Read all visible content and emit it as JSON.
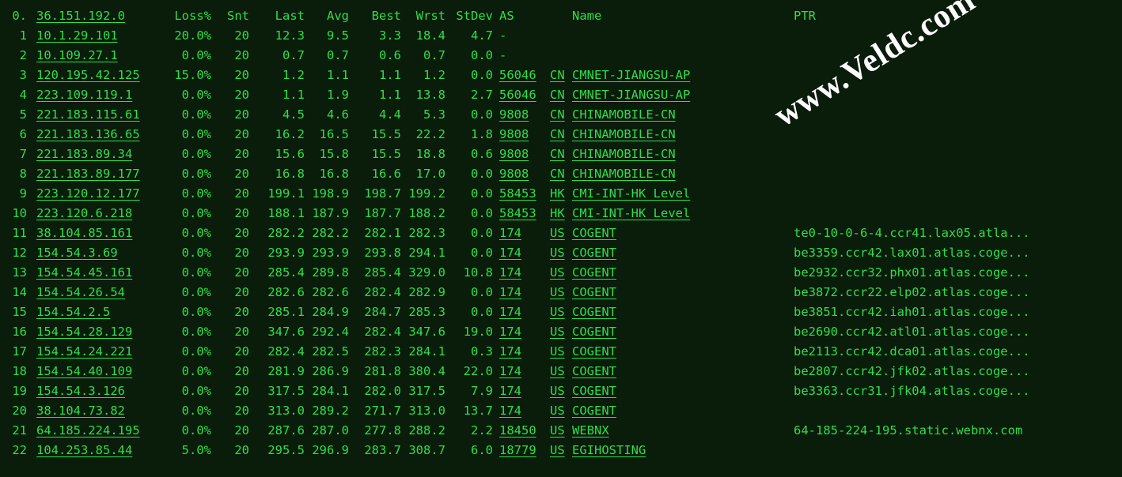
{
  "watermark": "www.Veldc.com",
  "header": {
    "hop": "0.",
    "ip": "36.151.192.0",
    "loss": "Loss%",
    "snt": "Snt",
    "last": "Last",
    "avg": "Avg",
    "best": "Best",
    "wrst": "Wrst",
    "stdev": "StDev",
    "as": "AS",
    "name": "Name",
    "ptr": "PTR"
  },
  "rows": [
    {
      "hop": "1",
      "ip": "10.1.29.101",
      "loss": "20.0%",
      "snt": "20",
      "last": "12.3",
      "avg": "9.5",
      "best": "3.3",
      "wrst": "18.4",
      "stdev": "4.7",
      "as": "-",
      "cc": "",
      "name": "",
      "ptr": ""
    },
    {
      "hop": "2",
      "ip": "10.109.27.1",
      "loss": "0.0%",
      "snt": "20",
      "last": "0.7",
      "avg": "0.7",
      "best": "0.6",
      "wrst": "0.7",
      "stdev": "0.0",
      "as": "-",
      "cc": "",
      "name": "",
      "ptr": ""
    },
    {
      "hop": "3",
      "ip": "120.195.42.125",
      "loss": "15.0%",
      "snt": "20",
      "last": "1.2",
      "avg": "1.1",
      "best": "1.1",
      "wrst": "1.2",
      "stdev": "0.0",
      "as": "56046",
      "cc": "CN",
      "name": "CMNET-JIANGSU-AP",
      "ptr": ""
    },
    {
      "hop": "4",
      "ip": "223.109.119.1",
      "loss": "0.0%",
      "snt": "20",
      "last": "1.1",
      "avg": "1.9",
      "best": "1.1",
      "wrst": "13.8",
      "stdev": "2.7",
      "as": "56046",
      "cc": "CN",
      "name": "CMNET-JIANGSU-AP",
      "ptr": ""
    },
    {
      "hop": "5",
      "ip": "221.183.115.61",
      "loss": "0.0%",
      "snt": "20",
      "last": "4.5",
      "avg": "4.6",
      "best": "4.4",
      "wrst": "5.3",
      "stdev": "0.0",
      "as": "9808",
      "cc": "CN",
      "name": "CHINAMOBILE-CN",
      "ptr": ""
    },
    {
      "hop": "6",
      "ip": "221.183.136.65",
      "loss": "0.0%",
      "snt": "20",
      "last": "16.2",
      "avg": "16.5",
      "best": "15.5",
      "wrst": "22.2",
      "stdev": "1.8",
      "as": "9808",
      "cc": "CN",
      "name": "CHINAMOBILE-CN",
      "ptr": ""
    },
    {
      "hop": "7",
      "ip": "221.183.89.34",
      "loss": "0.0%",
      "snt": "20",
      "last": "15.6",
      "avg": "15.8",
      "best": "15.5",
      "wrst": "18.8",
      "stdev": "0.6",
      "as": "9808",
      "cc": "CN",
      "name": "CHINAMOBILE-CN",
      "ptr": ""
    },
    {
      "hop": "8",
      "ip": "221.183.89.177",
      "loss": "0.0%",
      "snt": "20",
      "last": "16.8",
      "avg": "16.8",
      "best": "16.6",
      "wrst": "17.0",
      "stdev": "0.0",
      "as": "9808",
      "cc": "CN",
      "name": "CHINAMOBILE-CN",
      "ptr": ""
    },
    {
      "hop": "9",
      "ip": "223.120.12.177",
      "loss": "0.0%",
      "snt": "20",
      "last": "199.1",
      "avg": "198.9",
      "best": "198.7",
      "wrst": "199.2",
      "stdev": "0.0",
      "as": "58453",
      "cc": "HK",
      "name": "CMI-INT-HK Level",
      "ptr": ""
    },
    {
      "hop": "10",
      "ip": "223.120.6.218",
      "loss": "0.0%",
      "snt": "20",
      "last": "188.1",
      "avg": "187.9",
      "best": "187.7",
      "wrst": "188.2",
      "stdev": "0.0",
      "as": "58453",
      "cc": "HK",
      "name": "CMI-INT-HK Level",
      "ptr": ""
    },
    {
      "hop": "11",
      "ip": "38.104.85.161",
      "loss": "0.0%",
      "snt": "20",
      "last": "282.2",
      "avg": "282.2",
      "best": "282.1",
      "wrst": "282.3",
      "stdev": "0.0",
      "as": "174",
      "cc": "US",
      "name": "COGENT",
      "ptr": "te0-10-0-6-4.ccr41.lax05.atla..."
    },
    {
      "hop": "12",
      "ip": "154.54.3.69",
      "loss": "0.0%",
      "snt": "20",
      "last": "293.9",
      "avg": "293.9",
      "best": "293.8",
      "wrst": "294.1",
      "stdev": "0.0",
      "as": "174",
      "cc": "US",
      "name": "COGENT",
      "ptr": "be3359.ccr42.lax01.atlas.coge..."
    },
    {
      "hop": "13",
      "ip": "154.54.45.161",
      "loss": "0.0%",
      "snt": "20",
      "last": "285.4",
      "avg": "289.8",
      "best": "285.4",
      "wrst": "329.0",
      "stdev": "10.8",
      "as": "174",
      "cc": "US",
      "name": "COGENT",
      "ptr": "be2932.ccr32.phx01.atlas.coge..."
    },
    {
      "hop": "14",
      "ip": "154.54.26.54",
      "loss": "0.0%",
      "snt": "20",
      "last": "282.6",
      "avg": "282.6",
      "best": "282.4",
      "wrst": "282.9",
      "stdev": "0.0",
      "as": "174",
      "cc": "US",
      "name": "COGENT",
      "ptr": "be3872.ccr22.elp02.atlas.coge..."
    },
    {
      "hop": "15",
      "ip": "154.54.2.5",
      "loss": "0.0%",
      "snt": "20",
      "last": "285.1",
      "avg": "284.9",
      "best": "284.7",
      "wrst": "285.3",
      "stdev": "0.0",
      "as": "174",
      "cc": "US",
      "name": "COGENT",
      "ptr": "be3851.ccr42.iah01.atlas.coge..."
    },
    {
      "hop": "16",
      "ip": "154.54.28.129",
      "loss": "0.0%",
      "snt": "20",
      "last": "347.6",
      "avg": "292.4",
      "best": "282.4",
      "wrst": "347.6",
      "stdev": "19.0",
      "as": "174",
      "cc": "US",
      "name": "COGENT",
      "ptr": "be2690.ccr42.atl01.atlas.coge..."
    },
    {
      "hop": "17",
      "ip": "154.54.24.221",
      "loss": "0.0%",
      "snt": "20",
      "last": "282.4",
      "avg": "282.5",
      "best": "282.3",
      "wrst": "284.1",
      "stdev": "0.3",
      "as": "174",
      "cc": "US",
      "name": "COGENT",
      "ptr": "be2113.ccr42.dca01.atlas.coge..."
    },
    {
      "hop": "18",
      "ip": "154.54.40.109",
      "loss": "0.0%",
      "snt": "20",
      "last": "281.9",
      "avg": "286.9",
      "best": "281.8",
      "wrst": "380.4",
      "stdev": "22.0",
      "as": "174",
      "cc": "US",
      "name": "COGENT",
      "ptr": "be2807.ccr42.jfk02.atlas.coge..."
    },
    {
      "hop": "19",
      "ip": "154.54.3.126",
      "loss": "0.0%",
      "snt": "20",
      "last": "317.5",
      "avg": "284.1",
      "best": "282.0",
      "wrst": "317.5",
      "stdev": "7.9",
      "as": "174",
      "cc": "US",
      "name": "COGENT",
      "ptr": "be3363.ccr31.jfk04.atlas.coge..."
    },
    {
      "hop": "20",
      "ip": "38.104.73.82",
      "loss": "0.0%",
      "snt": "20",
      "last": "313.0",
      "avg": "289.2",
      "best": "271.7",
      "wrst": "313.0",
      "stdev": "13.7",
      "as": "174",
      "cc": "US",
      "name": "COGENT",
      "ptr": ""
    },
    {
      "hop": "21",
      "ip": "64.185.224.195",
      "loss": "0.0%",
      "snt": "20",
      "last": "287.6",
      "avg": "287.0",
      "best": "277.8",
      "wrst": "288.2",
      "stdev": "2.2",
      "as": "18450",
      "cc": "US",
      "name": "WEBNX",
      "ptr": "64-185-224-195.static.webnx.com"
    },
    {
      "hop": "22",
      "ip": "104.253.85.44",
      "loss": "5.0%",
      "snt": "20",
      "last": "295.5",
      "avg": "296.9",
      "best": "283.7",
      "wrst": "308.7",
      "stdev": "6.0",
      "as": "18779",
      "cc": "US",
      "name": "EGIHOSTING",
      "ptr": ""
    }
  ]
}
